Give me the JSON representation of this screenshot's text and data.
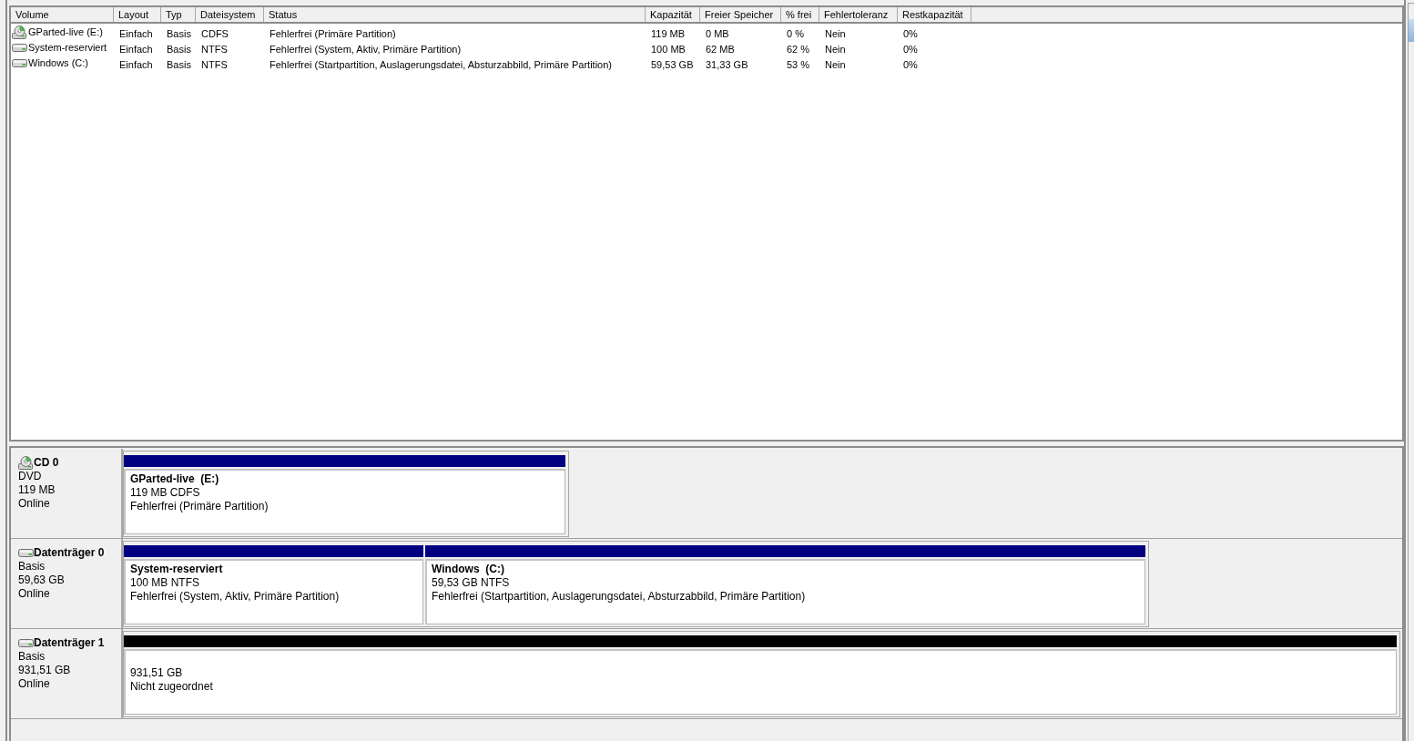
{
  "volume_list": {
    "columns": [
      "Volume",
      "Layout",
      "Typ",
      "Dateisystem",
      "Status",
      "Kapazität",
      "Freier Speicher",
      "% frei",
      "Fehlertoleranz",
      "Restkapazität"
    ],
    "rows": [
      {
        "kind": "cd",
        "cells": [
          "GParted-live (E:)",
          "Einfach",
          "Basis",
          "CDFS",
          "Fehlerfrei (Primäre Partition)",
          "119 MB",
          "0 MB",
          "0 %",
          "Nein",
          "0%"
        ]
      },
      {
        "kind": "disk",
        "cells": [
          "System-reserviert",
          "Einfach",
          "Basis",
          "NTFS",
          "Fehlerfrei (System, Aktiv, Primäre Partition)",
          "100 MB",
          "62 MB",
          "62 %",
          "Nein",
          "0%"
        ]
      },
      {
        "kind": "disk",
        "cells": [
          "Windows (C:)",
          "Einfach",
          "Basis",
          "NTFS",
          "Fehlerfrei (Startpartition, Auslagerungsdatei, Absturzabbild, Primäre Partition)",
          "59,53 GB",
          "31,33 GB",
          "53 %",
          "Nein",
          "0%"
        ]
      }
    ]
  },
  "disk_map": {
    "disks": [
      {
        "kind": "cd",
        "name": "CD 0",
        "details": [
          "DVD",
          "119 MB",
          "Online"
        ],
        "partitions": [
          {
            "color": "#000080",
            "name": "GParted-live  (E:)",
            "details": [
              "119 MB CDFS",
              "Fehlerfrei (Primäre Partition)"
            ]
          }
        ]
      },
      {
        "kind": "disk",
        "name": "Datenträger 0",
        "details": [
          "Basis",
          "59,63 GB",
          "Online"
        ],
        "partitions": [
          {
            "color": "#000080",
            "name": "System-reserviert",
            "details": [
              "100 MB NTFS",
              "Fehlerfrei (System, Aktiv, Primäre Partition)"
            ]
          },
          {
            "color": "#000080",
            "name": "Windows  (C:)",
            "details": [
              "59,53 GB NTFS",
              "Fehlerfrei (Startpartition, Auslagerungsdatei, Absturzabbild, Primäre Partition)"
            ]
          }
        ]
      },
      {
        "kind": "disk",
        "name": "Datenträger 1",
        "details": [
          "Basis",
          "931,51 GB",
          "Online"
        ],
        "partitions": [
          {
            "color": "#000000",
            "details": [
              "931,51 GB",
              "Nicht zugeordnet"
            ]
          }
        ]
      }
    ]
  }
}
